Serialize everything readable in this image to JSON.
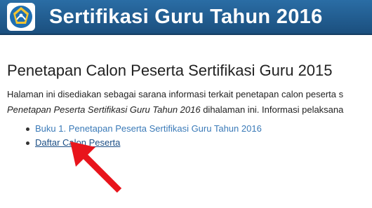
{
  "header": {
    "title": "Sertifikasi Guru Tahun 2016",
    "logo_icon": "tut-wuri-handayani-logo"
  },
  "main": {
    "page_title": "Penetapan Calon Peserta Sertifikasi Guru 2015",
    "intro_line1": "Halaman ini disediakan sebagai sarana informasi terkait penetapan calon peserta s",
    "intro_line2_italic": "Penetapan Peserta Sertifikasi Guru Tahun 2016",
    "intro_line2_rest": " dihalaman ini. Informasi pelaksana",
    "links": [
      {
        "label": "Buku 1. Penetapan Peserta Sertifikasi Guru Tahun 2016"
      },
      {
        "label": "Daftar Calon Peserta"
      }
    ]
  },
  "annotation": {
    "icon": "red-arrow-icon",
    "color": "#e8141c"
  },
  "colors": {
    "header_bg": "#1f5a8e",
    "link": "#3a7ab8",
    "link_visited": "#1c4f86"
  }
}
